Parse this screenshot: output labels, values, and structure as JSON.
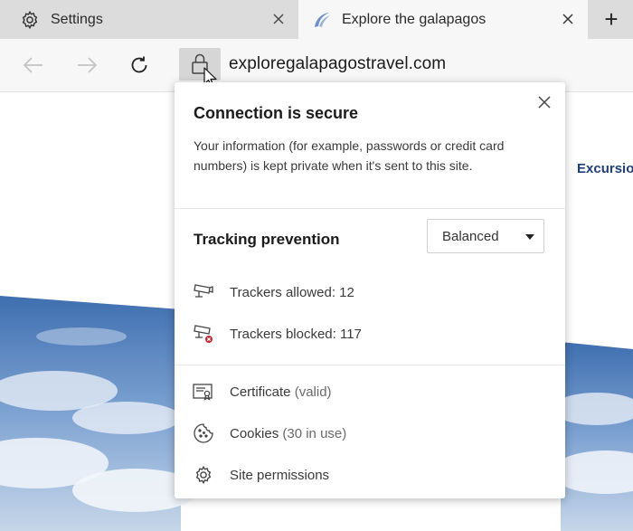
{
  "tabs": [
    {
      "label": "Settings",
      "icon": "gear-icon"
    },
    {
      "label": "Explore the galapagos",
      "icon": "site-logo-icon",
      "active": true
    }
  ],
  "new_tab_label": "+",
  "address_bar": {
    "url": "exploregalapagostravel.com"
  },
  "page": {
    "nav_link": "Excursio"
  },
  "flyout": {
    "title": "Connection is secure",
    "description": "Your information (for example, passwords or credit card numbers) is kept private when it's sent to this site.",
    "tracking": {
      "title": "Tracking prevention",
      "level": "Balanced",
      "allowed_label": "Trackers allowed: 12",
      "blocked_label": "Trackers blocked: 117"
    },
    "certificate": {
      "label": "Certificate",
      "status": "(valid)"
    },
    "cookies": {
      "label": "Cookies",
      "status": "(30 in use)"
    },
    "permissions_label": "Site permissions"
  },
  "colors": {
    "accent": "#1f3f7a",
    "blocked_badge": "#c4262e",
    "sky_blue": "#3f6fb0"
  }
}
